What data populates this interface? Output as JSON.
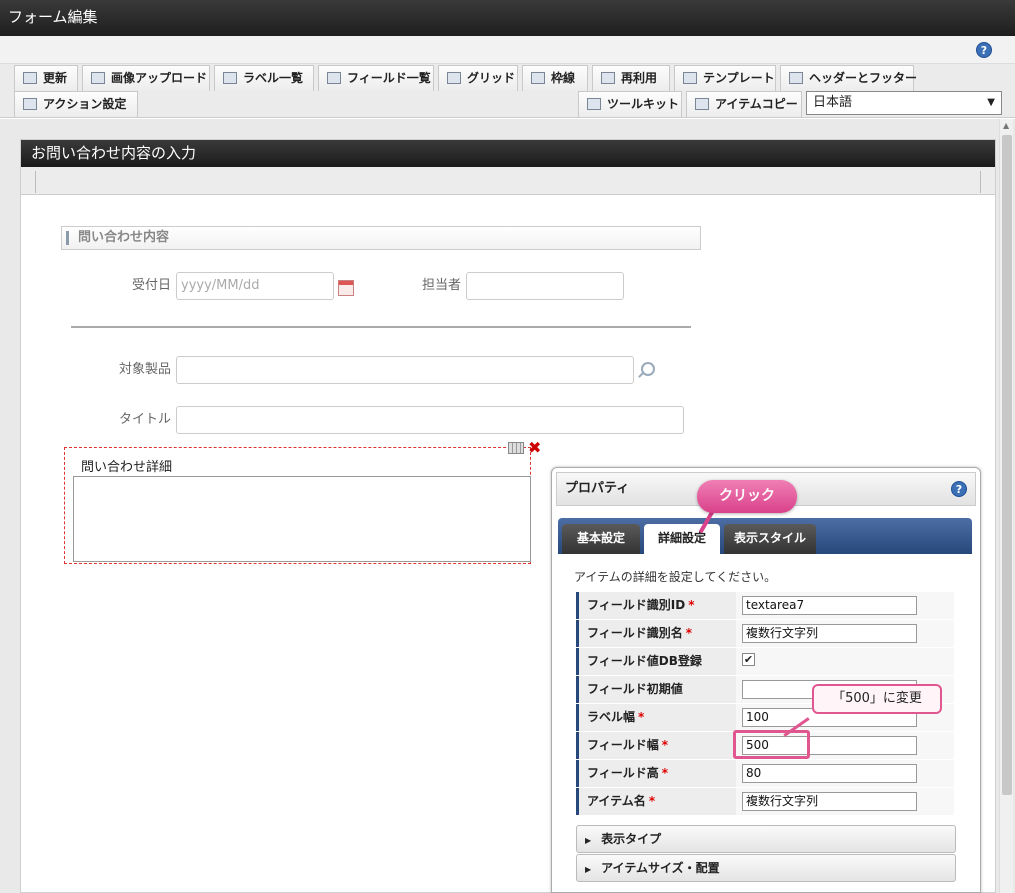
{
  "window": {
    "title": "フォーム編集"
  },
  "toolbar": {
    "row1": [
      {
        "label": "更新",
        "icon": "refresh-icon"
      },
      {
        "label": "画像アップロード",
        "icon": "image-upload-icon"
      },
      {
        "label": "ラベル一覧",
        "icon": "label-list-icon"
      },
      {
        "label": "フィールド一覧",
        "icon": "field-list-icon"
      },
      {
        "label": "グリッド",
        "icon": "grid-icon"
      },
      {
        "label": "枠線",
        "icon": "border-icon"
      },
      {
        "label": "再利用",
        "icon": "reuse-icon"
      },
      {
        "label": "テンプレート",
        "icon": "template-icon"
      },
      {
        "label": "ヘッダーとフッター",
        "icon": "header-footer-icon"
      }
    ],
    "row2_left": [
      {
        "label": "アクション設定",
        "icon": "action-icon"
      }
    ],
    "row2_right": [
      {
        "label": "ツールキット",
        "icon": "toolkit-icon"
      },
      {
        "label": "アイテムコピー",
        "icon": "item-copy-icon"
      }
    ],
    "language": "日本語"
  },
  "form": {
    "title": "お問い合わせ内容の入力",
    "section_title": "問い合わせ内容",
    "fields": {
      "date_label": "受付日",
      "date_placeholder": "yyyy/MM/dd",
      "assignee_label": "担当者",
      "product_label": "対象製品",
      "title_label": "タイトル",
      "details_label": "問い合わせ詳細"
    }
  },
  "properties": {
    "header": "プロパティ",
    "tabs": [
      "基本設定",
      "詳細設定",
      "表示スタイル"
    ],
    "active_tab": "詳細設定",
    "description": "アイテムの詳細を設定してください。",
    "rows": [
      {
        "name": "フィールド識別ID",
        "required": "*",
        "value": "textarea7"
      },
      {
        "name": "フィールド識別名",
        "required": "*",
        "value": "複数行文字列"
      },
      {
        "name": "フィールド値DB登録",
        "required": "",
        "checked": "✔"
      },
      {
        "name": "フィールド初期値",
        "required": "",
        "value": ""
      },
      {
        "name": "ラベル幅",
        "required": "*",
        "value": "100"
      },
      {
        "name": "フィールド幅",
        "required": "*",
        "value": "500"
      },
      {
        "name": "フィールド高",
        "required": "*",
        "value": "80"
      },
      {
        "name": "アイテム名",
        "required": "*",
        "value": "複数行文字列"
      }
    ],
    "sections": [
      "表示タイプ",
      "アイテムサイズ・配置"
    ]
  },
  "annotations": {
    "click": "クリック",
    "change": "「500」に変更"
  },
  "colors": {
    "accent_pink": "#d9418a",
    "tab_blue": "#27487a",
    "title_dark": "#1e1e1e"
  }
}
